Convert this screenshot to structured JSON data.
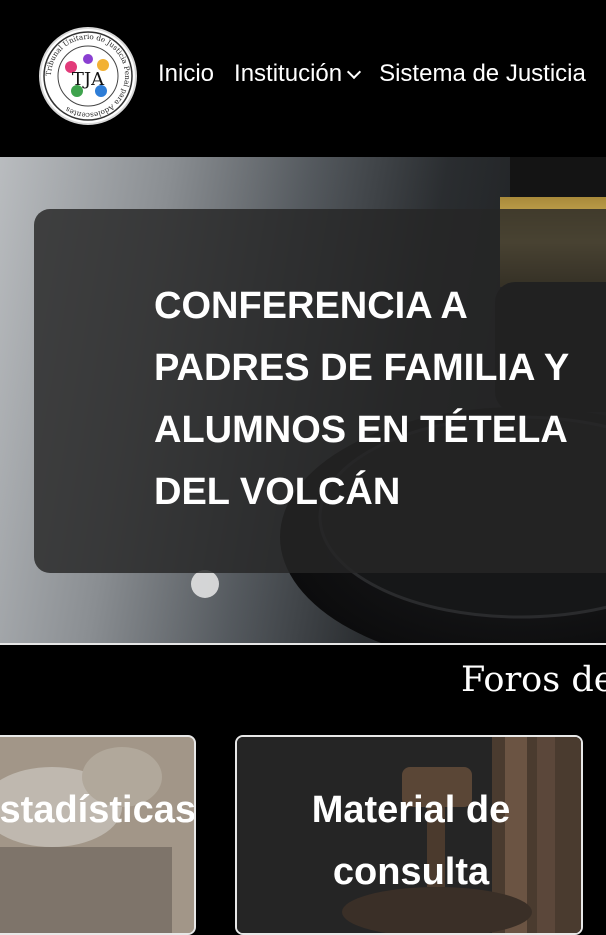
{
  "header": {
    "logo_text": "TJA",
    "logo_ring_text": "Tribunal Unitario de Justicia Penal para Adolescentes",
    "nav": [
      {
        "label": "Inicio",
        "has_dropdown": false
      },
      {
        "label": "Institución",
        "has_dropdown": true
      },
      {
        "label": "Sistema de Justicia",
        "has_dropdown": false
      }
    ]
  },
  "hero": {
    "title": "CONFERENCIA A PADRES DE FAMILIA Y ALUMNOS EN TÉTELA DEL VOLCÁN"
  },
  "section": {
    "heading": "Foros de"
  },
  "cards": [
    {
      "title": "Sesiones y Estadísticas"
    },
    {
      "title": "Material de consulta"
    }
  ],
  "colors": {
    "background": "#000000",
    "card_bg": "#262626",
    "text": "#ffffff"
  }
}
